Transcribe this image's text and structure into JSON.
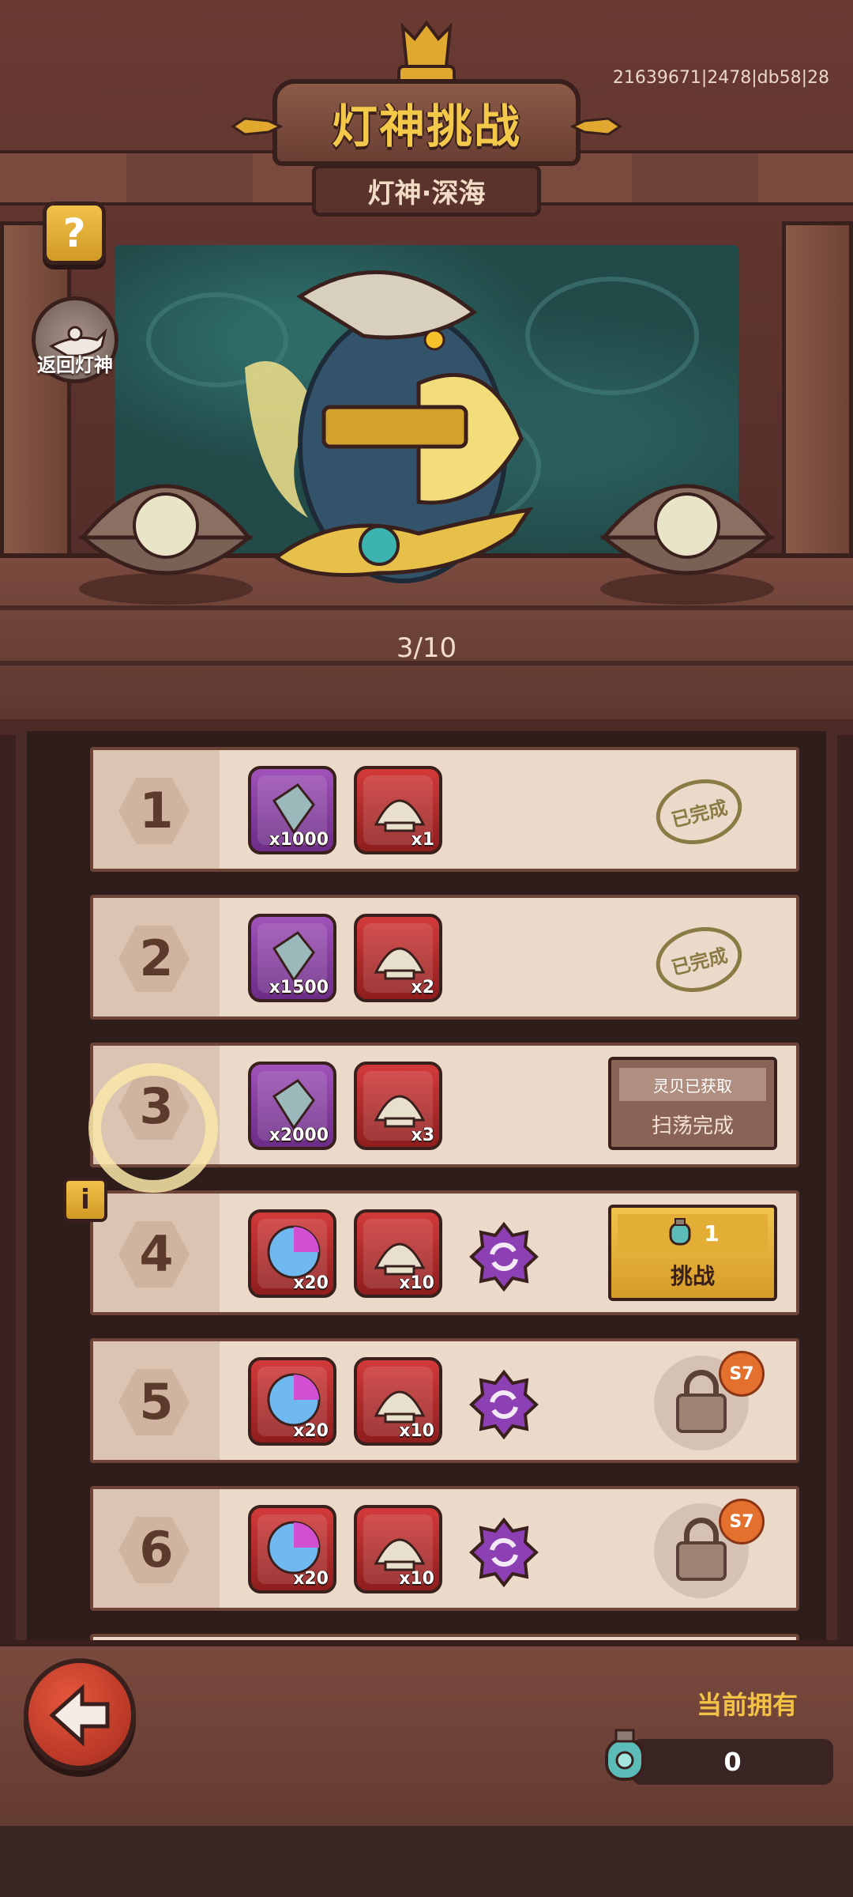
{
  "header": {
    "title": "灯神挑战",
    "subtitle": "灯神·深海",
    "build_id": "21639671|2478|db58|28",
    "help_label": "?",
    "return_label": "返回灯神"
  },
  "stage": {
    "progress": "3/10"
  },
  "levels": [
    {
      "number": "1",
      "rewards": [
        {
          "icon": "crystal-icon",
          "qty": "x1000"
        },
        {
          "icon": "shell-icon",
          "qty": "x1"
        }
      ],
      "status": "completed",
      "stamp": "已完成"
    },
    {
      "number": "2",
      "rewards": [
        {
          "icon": "crystal-icon",
          "qty": "x1500"
        },
        {
          "icon": "shell-icon",
          "qty": "x2"
        }
      ],
      "status": "completed",
      "stamp": "已完成"
    },
    {
      "number": "3",
      "rewards": [
        {
          "icon": "crystal-icon",
          "qty": "x2000"
        },
        {
          "icon": "shell-icon",
          "qty": "x3"
        }
      ],
      "status": "swept",
      "sweep_top": "灵贝已获取",
      "sweep_bottom": "扫荡完成"
    },
    {
      "number": "4",
      "rewards": [
        {
          "icon": "orb-icon",
          "qty": "x20"
        },
        {
          "icon": "shell-icon",
          "qty": "x10"
        }
      ],
      "status": "challenge",
      "cost": "1",
      "button_label": "挑战"
    },
    {
      "number": "5",
      "rewards": [
        {
          "icon": "orb-icon",
          "qty": "x20"
        },
        {
          "icon": "shell-icon",
          "qty": "x10"
        }
      ],
      "status": "locked",
      "lock_label": "S7"
    },
    {
      "number": "6",
      "rewards": [
        {
          "icon": "orb-icon",
          "qty": "x20"
        },
        {
          "icon": "shell-icon",
          "qty": "x10"
        }
      ],
      "status": "locked",
      "lock_label": "S7"
    }
  ],
  "info_label": "i",
  "footer": {
    "owned_label": "当前拥有",
    "owned_value": "0"
  },
  "colors": {
    "title_gold": "#f4c94a",
    "wood_dark": "#3a201d",
    "row_bg": "#ebd9ca",
    "lock_badge": "#e3702c"
  }
}
